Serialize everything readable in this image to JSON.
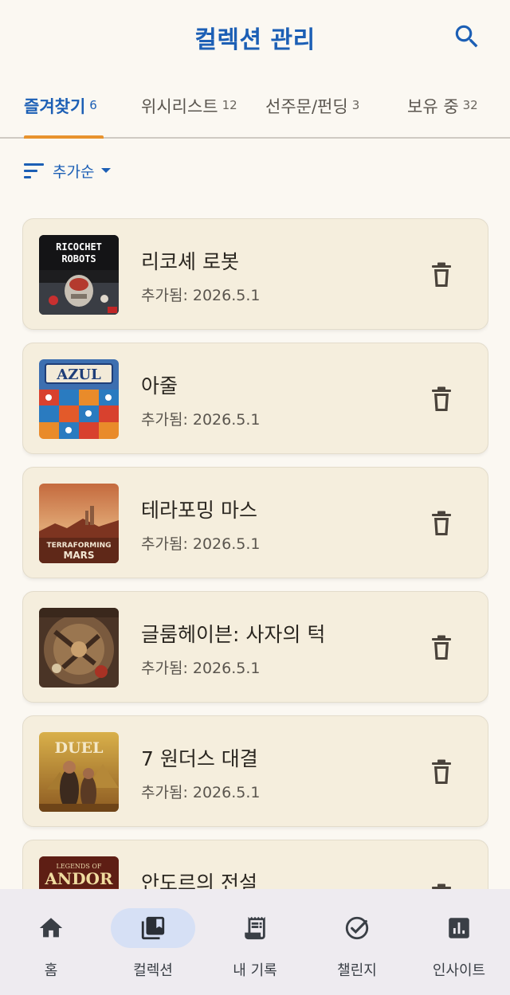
{
  "header": {
    "title": "컬렉션 관리"
  },
  "tabs": [
    {
      "label": "즐겨찾기",
      "count": "6",
      "active": true
    },
    {
      "label": "위시리스트",
      "count": "12"
    },
    {
      "label": "선주문/펀딩",
      "count": "3"
    },
    {
      "label": "보유 중",
      "count": "32"
    }
  ],
  "sort": {
    "label": "추가순"
  },
  "items": [
    {
      "title": "리코셰 로봇",
      "date": "추가됨: 2026.5.1",
      "thumb_text": "RICOCHET ROBOTS"
    },
    {
      "title": "아줄",
      "date": "추가됨: 2026.5.1",
      "thumb_text": "AZUL"
    },
    {
      "title": "테라포밍 마스",
      "date": "추가됨: 2026.5.1",
      "thumb_text": "TERRAFORMING MARS"
    },
    {
      "title": "글룸헤이븐: 사자의 턱",
      "date": "추가됨: 2026.5.1",
      "thumb_text": ""
    },
    {
      "title": "7 원더스 대결",
      "date": "추가됨: 2026.5.1",
      "thumb_text": "DUEL"
    },
    {
      "title": "안도르의 전설",
      "date": "",
      "thumb_text": "ANDOR"
    }
  ],
  "nav": [
    {
      "label": "홈",
      "icon": "home-icon"
    },
    {
      "label": "컬렉션",
      "icon": "collections-icon",
      "active": true
    },
    {
      "label": "내 기록",
      "icon": "receipt-icon"
    },
    {
      "label": "챌린지",
      "icon": "check-circle-icon"
    },
    {
      "label": "인사이트",
      "icon": "insights-icon"
    }
  ],
  "colors": {
    "accent": "#1c5fb5",
    "tab_indicator": "#e8932e",
    "card_bg": "#f5eedd",
    "page_bg": "#fbf8f2",
    "nav_bg": "#eeebf0",
    "nav_active_pill": "#d6e0f5"
  }
}
